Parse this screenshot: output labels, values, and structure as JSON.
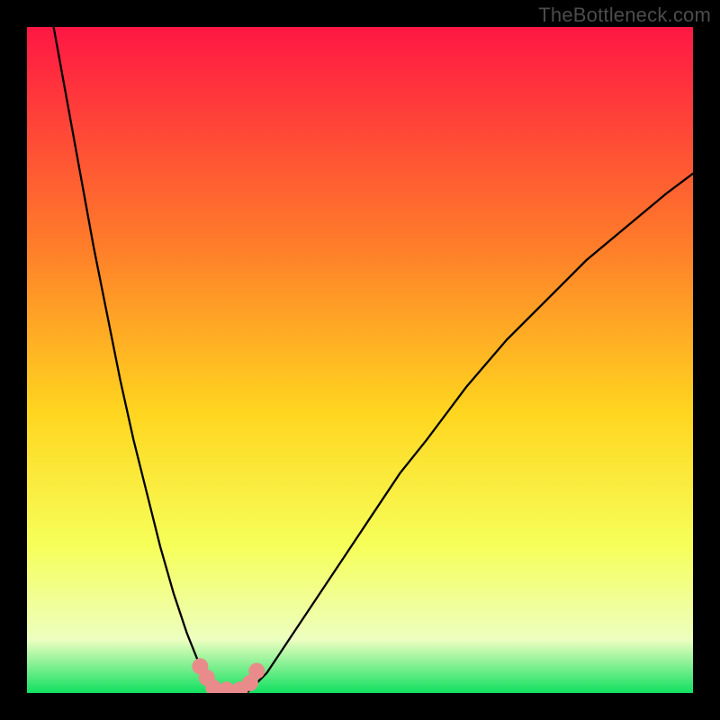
{
  "watermark": "TheBottleneck.com",
  "chart_data": {
    "type": "line",
    "title": "",
    "xlabel": "",
    "ylabel": "",
    "xlim": [
      0,
      100
    ],
    "ylim": [
      0,
      100
    ],
    "series": [
      {
        "name": "left-curve",
        "x": [
          4,
          6,
          8,
          10,
          12,
          14,
          16,
          18,
          20,
          22,
          24,
          26,
          27,
          28,
          29
        ],
        "y": [
          100,
          89,
          78,
          67,
          57,
          47,
          38,
          30,
          22,
          15,
          9,
          4,
          2,
          1,
          0
        ]
      },
      {
        "name": "right-curve",
        "x": [
          33,
          34,
          36,
          38,
          40,
          44,
          48,
          52,
          56,
          60,
          66,
          72,
          78,
          84,
          90,
          96,
          100
        ],
        "y": [
          0,
          1,
          3,
          6,
          9,
          15,
          21,
          27,
          33,
          38,
          46,
          53,
          59,
          65,
          70,
          75,
          78
        ]
      }
    ],
    "markers": {
      "name": "highlight-points",
      "points": [
        {
          "x": 26.0,
          "y": 4.0
        },
        {
          "x": 27.0,
          "y": 2.3
        },
        {
          "x": 28.0,
          "y": 0.8
        },
        {
          "x": 30.0,
          "y": 0.5
        },
        {
          "x": 32.0,
          "y": 0.5
        },
        {
          "x": 33.5,
          "y": 1.5
        },
        {
          "x": 34.5,
          "y": 3.3
        }
      ],
      "color": "#e98b8b",
      "radius_px": 9
    },
    "background_gradient": {
      "top": "#ff1744",
      "upper_mid": "#ff7a2a",
      "mid": "#ffd61f",
      "lower_mid": "#f6ff5a",
      "pale": "#edffc0",
      "bottom": "#10e060"
    }
  }
}
